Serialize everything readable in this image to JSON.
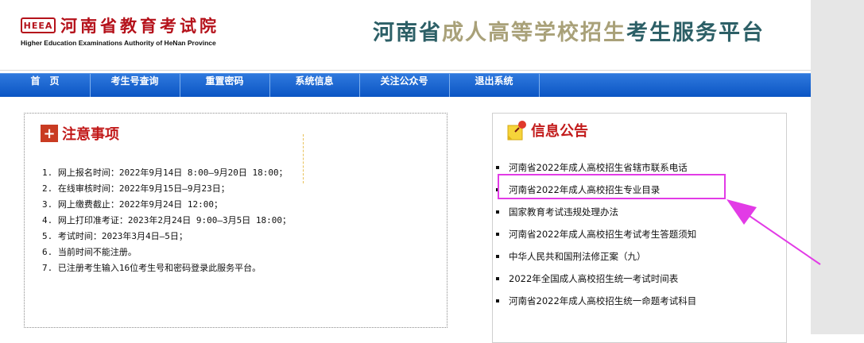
{
  "header": {
    "logo_mark": "HEEA",
    "logo_cn": "河南省教育考试院",
    "logo_en": "Higher Education Examinations Authority of HeNan Province",
    "title_part1": "河南省",
    "title_part2": "成人高等学校招生",
    "title_part3": "考生服务平台"
  },
  "nav": {
    "items": [
      "首　页",
      "考生号查询",
      "重置密码",
      "系统信息",
      "关注公众号",
      "退出系统"
    ]
  },
  "notice": {
    "title": "注意事项",
    "items": [
      "1. 网上报名时间：2022年9月14日 8:00—9月20日 18:00；",
      "2. 在线审核时间：2022年9月15日—9月23日；",
      "3. 网上缴费截止：2022年9月24日 12:00；",
      "4. 网上打印准考证：2023年2月24日 9:00—3月5日 18:00；",
      "5. 考试时间：2023年3月4日—5日；",
      "6. 当前时间不能注册。",
      "7. 已注册考生输入16位考生号和密码登录此服务平台。"
    ]
  },
  "announcements": {
    "title": "信息公告",
    "items": [
      "河南省2022年成人高校招生省辖市联系电话",
      "河南省2022年成人高校招生专业目录",
      "国家教育考试违规处理办法",
      "河南省2022年成人高校招生考试考生答题须知",
      "中华人民共和国刑法修正案（九）",
      "2022年全国成人高校招生统一考试时间表",
      "河南省2022年成人高校招生统一命题考试科目"
    ]
  },
  "colors": {
    "nav_blue": "#0b55c4",
    "brand_red": "#b5121b",
    "highlight_magenta": "#e23be6",
    "title_teal": "#2c5f66",
    "title_khaki": "#a9a179"
  }
}
